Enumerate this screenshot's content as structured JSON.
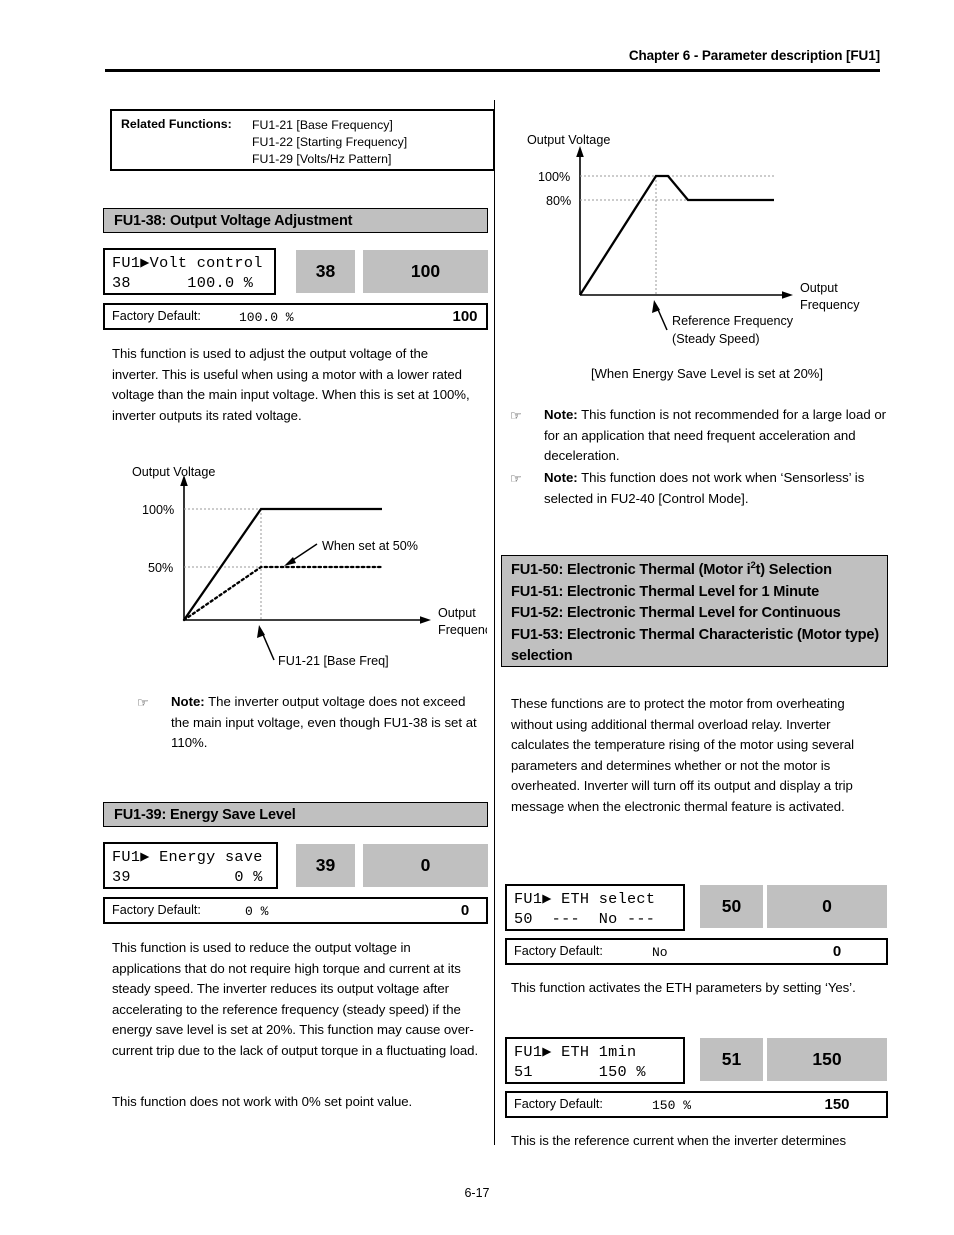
{
  "header": {
    "chapter_title": "Chapter 6 - Parameter description [FU1]"
  },
  "footer": {
    "page_number": "6-17"
  },
  "related_functions": {
    "label": "Related Functions:",
    "items": [
      "FU1-21 [Base Frequency]",
      "FU1-22 [Starting Frequency]",
      "FU1-29 [Volts/Hz Pattern]"
    ]
  },
  "sections": {
    "fu1_38": {
      "heading": "FU1-38: Output Voltage Adjustment",
      "keypad": {
        "line1": "FU1▶Volt control",
        "line2": "38      100.0 %",
        "code": "38",
        "value": "100"
      },
      "factory_default": {
        "label": "Factory Default:",
        "value_text": "100.0 %",
        "value_num": "100"
      },
      "body": "This function is used to adjust the output voltage of the inverter. This is useful when using a motor with a lower rated voltage than the main input voltage. When this is set at 100%, inverter outputs its rated voltage.",
      "note": {
        "prefix": "Note:",
        "text": " The inverter output voltage does not exceed the main input voltage, even though FU1-38 is set at 110%."
      }
    },
    "fu1_39": {
      "heading": "FU1-39: Energy Save Level",
      "keypad": {
        "line1": "FU1▶ Energy save",
        "line2": "39           0 %",
        "code": "39",
        "value": "0"
      },
      "factory_default": {
        "label": "Factory Default:",
        "value_text": "0 %",
        "value_num": "0"
      },
      "body": "This function is used to reduce the output voltage in applications that do not require high torque and current at its steady speed. The inverter reduces its output voltage after accelerating to the reference frequency (steady speed) if the energy save level is set at 20%. This function may cause over-current trip due to the lack of output torque in a fluctuating load.",
      "body2": "This function does not work with 0% set point value."
    },
    "fu1_50_53": {
      "heading_lines": [
        "FU1-50: Electronic Thermal (Motor i²t) Selection",
        "FU1-51: Electronic Thermal Level for 1 Minute",
        "FU1-52: Electronic Thermal Level for Continuous",
        "FU1-53: Electronic Thermal Characteristic (Motor type) selection"
      ],
      "body": "These functions are to protect the motor from overheating without using additional thermal overload relay. Inverter calculates the temperature rising of the motor using several parameters and determines whether or not the motor is overheated. Inverter will turn off its output and display a trip message when the electronic thermal feature is activated.",
      "keypad_50": {
        "line1": "FU1▶ ETH select",
        "line2": "50  ---  No ---",
        "code": "50",
        "value": "0"
      },
      "factory_default_50": {
        "label": "Factory Default:",
        "value_text": "No",
        "value_num": "0"
      },
      "body_50": "This function activates the ETH parameters by setting ‘Yes’.",
      "keypad_51": {
        "line1": "FU1▶ ETH 1min",
        "line2": "51       150 %",
        "code": "51",
        "value": "150"
      },
      "factory_default_51": {
        "label": "Factory Default:",
        "value_text": "150 %",
        "value_num": "150"
      },
      "body_51": "This is the reference current when the inverter determines"
    }
  },
  "notes_right": [
    {
      "prefix": "Note:",
      "text": " This function is not recommended for a large load or for an application that need frequent acceleration and deceleration."
    },
    {
      "prefix": "Note:",
      "text": " This function does not work when ‘Sensorless’ is selected in FU2-40 [Control Mode]."
    }
  ],
  "chart_data": [
    {
      "id": "fu1-38-graph",
      "type": "line",
      "title": "",
      "xlabel": "Output Frequency",
      "ylabel": "Output Voltage",
      "ytick_labels": [
        "100%",
        "50%"
      ],
      "grid": true,
      "annotations": [
        {
          "text": "When set at 50%",
          "target": "dotted-curve"
        },
        {
          "text": "FU1-21 [Base Freq]",
          "target": "x-axis-base-frequency"
        }
      ],
      "series": [
        {
          "name": "100% setting",
          "style": "solid",
          "points": [
            [
              0,
              0
            ],
            [
              0.42,
              100
            ],
            [
              1.0,
              100
            ]
          ]
        },
        {
          "name": "When set at 50%",
          "style": "dotted",
          "points": [
            [
              0,
              0
            ],
            [
              0.42,
              50
            ],
            [
              1.0,
              50
            ]
          ]
        }
      ]
    },
    {
      "id": "fu1-39-graph",
      "type": "line",
      "title": "",
      "caption": "[When Energy Save Level is set at 20%]",
      "xlabel": "Output Frequency",
      "ylabel": "Output Voltage",
      "ytick_labels": [
        "100%",
        "80%"
      ],
      "grid": true,
      "annotations": [
        {
          "text": "Reference Frequency",
          "target": "x-axis-reference-frequency"
        },
        {
          "text": "(Steady Speed)",
          "target": "x-axis-reference-frequency"
        }
      ],
      "series": [
        {
          "name": "Energy save 20%",
          "style": "solid",
          "points": [
            [
              0,
              0
            ],
            [
              0.4,
              100
            ],
            [
              0.46,
              100
            ],
            [
              0.56,
              80
            ],
            [
              1.0,
              80
            ]
          ]
        }
      ]
    }
  ]
}
